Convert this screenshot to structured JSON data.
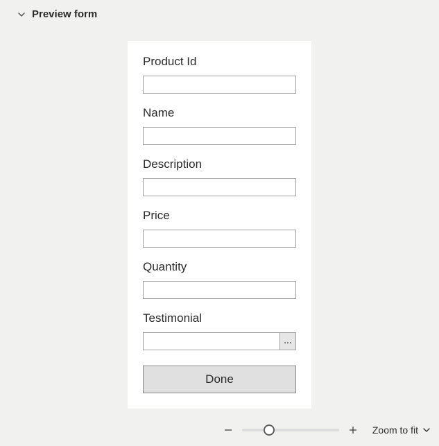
{
  "header": {
    "title": "Preview form"
  },
  "form": {
    "fields": [
      {
        "label": "Product Id",
        "value": ""
      },
      {
        "label": "Name",
        "value": ""
      },
      {
        "label": "Description",
        "value": ""
      },
      {
        "label": "Price",
        "value": ""
      },
      {
        "label": "Quantity",
        "value": ""
      },
      {
        "label": "Testimonial",
        "value": "",
        "has_picker": true
      }
    ],
    "picker_label": "...",
    "done_label": "Done"
  },
  "footer": {
    "zoom_fit_label": "Zoom to fit",
    "slider_position_percent": 28
  }
}
